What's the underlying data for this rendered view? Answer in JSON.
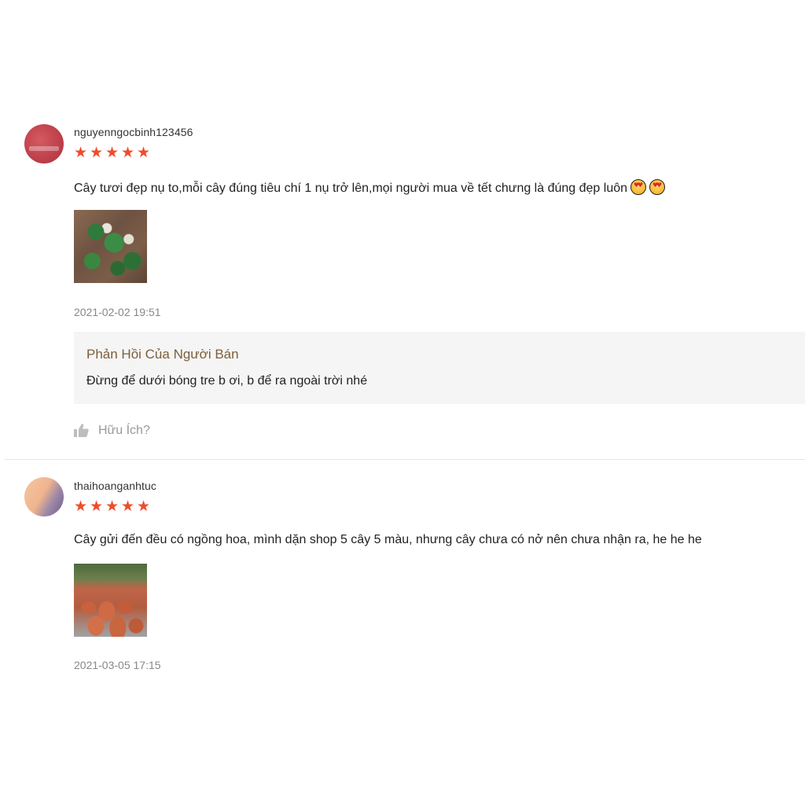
{
  "reviews": [
    {
      "username": "nguyenngocbinh123456",
      "rating": 5,
      "stars": [
        "★",
        "★",
        "★",
        "★",
        "★"
      ],
      "comment": "Cây tươi đẹp nụ to,mỗi cây đúng tiêu chí 1 nụ trở lên,mọi người mua về tết chưng là đúng đẹp luôn",
      "emojis": [
        "heart-eyes-emoji",
        "heart-eyes-emoji"
      ],
      "photo": "plant-photo",
      "date": "2021-02-02 19:51",
      "seller_reply": {
        "title": "Phản Hồi Của Người Bán",
        "text": "Đừng để dưới bóng tre b ơi, b để ra ngoài trời nhé"
      },
      "helpful_label": "Hữu Ích?"
    },
    {
      "username": "thaihoanganhtuc",
      "rating": 5,
      "stars": [
        "★",
        "★",
        "★",
        "★",
        "★"
      ],
      "comment": "Cây gửi đến đều có ngồng hoa, mình dặn shop 5 cây 5 màu, nhưng cây chưa có nở nên chưa nhận ra, he he he",
      "photo": "pots-photo",
      "date": "2021-03-05 17:15"
    }
  ],
  "colors": {
    "star": "#ee4d2d",
    "seller_title": "#7d5f3a",
    "muted": "#888888",
    "reply_bg": "#f5f5f5"
  },
  "icons": {
    "thumb": "thumbs-up-icon"
  }
}
